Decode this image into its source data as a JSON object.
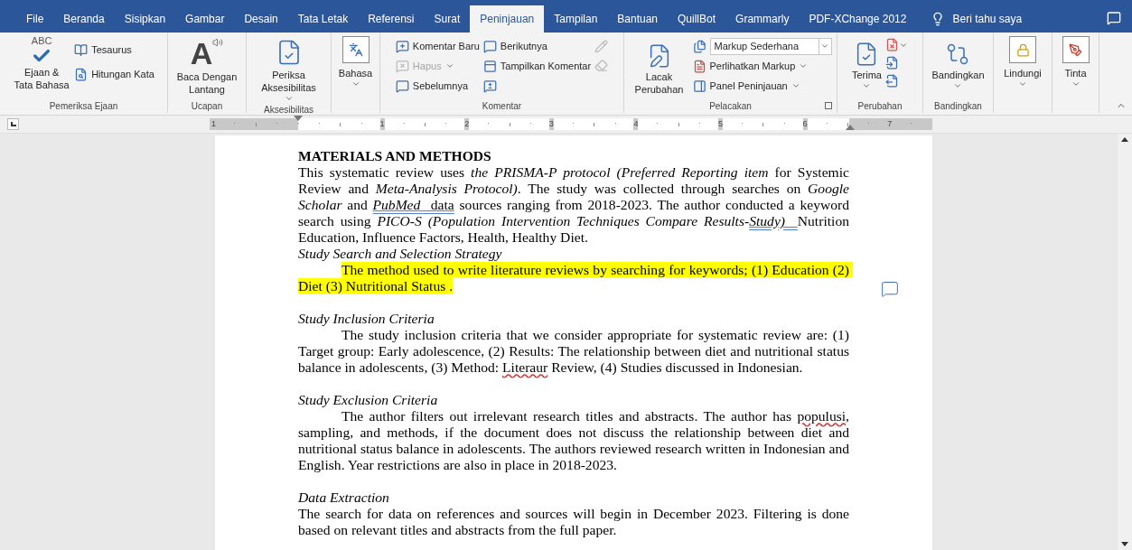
{
  "tabs": [
    {
      "label": "File",
      "selected": false
    },
    {
      "label": "Beranda",
      "selected": false
    },
    {
      "label": "Sisipkan",
      "selected": false
    },
    {
      "label": "Gambar",
      "selected": false
    },
    {
      "label": "Desain",
      "selected": false
    },
    {
      "label": "Tata Letak",
      "selected": false
    },
    {
      "label": "Referensi",
      "selected": false
    },
    {
      "label": "Surat",
      "selected": false
    },
    {
      "label": "Peninjauan",
      "selected": true
    },
    {
      "label": "Tampilan",
      "selected": false
    },
    {
      "label": "Bantuan",
      "selected": false
    },
    {
      "label": "QuillBot",
      "selected": false
    },
    {
      "label": "Grammarly",
      "selected": false
    },
    {
      "label": "PDF-XChange 2012",
      "selected": false
    }
  ],
  "tell_me": {
    "label": "Beri tahu saya"
  },
  "ribbon": {
    "groups": [
      {
        "label": "Pemeriksa Ejaan",
        "controls": [
          {
            "label": "Ejaan & Tata Bahasa",
            "icon_text": "ABC"
          },
          {
            "label": "Tesaurus"
          },
          {
            "label": "Hitungan Kata"
          }
        ]
      },
      {
        "label": "Ucapan",
        "controls": [
          {
            "label": "Baca Dengan Lantang",
            "icon_text": "A"
          }
        ]
      },
      {
        "label": "Aksesibilitas",
        "controls": [
          {
            "label": "Periksa Aksesibilitas"
          }
        ]
      },
      {
        "controls": [
          {
            "label": "Bahasa"
          }
        ]
      },
      {
        "label": "Komentar",
        "controls": [
          {
            "label": "Komentar Baru",
            "disabled": false
          },
          {
            "label": "Hapus",
            "disabled": true
          },
          {
            "label": "Sebelumnya",
            "disabled": false
          },
          {
            "label": "Berikutnya",
            "disabled": false
          },
          {
            "label": "Tampilkan Komentar",
            "disabled": false
          }
        ]
      },
      {
        "label": "Pelacakan",
        "controls": [
          {
            "label": "Lacak Perubahan"
          },
          {
            "value": "Markup Sederhana"
          },
          {
            "label": "Perlihatkan Markup"
          },
          {
            "label": "Panel Peninjauan"
          }
        ]
      },
      {
        "label": "Perubahan",
        "controls": [
          {
            "label": "Terima"
          }
        ]
      },
      {
        "label": "Bandingkan",
        "controls": [
          {
            "label": "Bandingkan"
          }
        ]
      },
      {
        "controls": [
          {
            "label": "Lindungi"
          }
        ]
      },
      {
        "controls": [
          {
            "label": "Tinta"
          }
        ]
      }
    ]
  },
  "ruler": {
    "numbers": [
      "1",
      "1",
      "2",
      "3",
      "4",
      "5",
      "6",
      "7"
    ]
  },
  "document": {
    "paragraphs": [
      {
        "kind": "heading",
        "runs": [
          {
            "text": "MATERIALS AND METHODS",
            "italic": false
          }
        ]
      },
      {
        "kind": "body",
        "gap_before": false,
        "indent": false,
        "highlight": false,
        "runs": [
          {
            "text": "This systematic review uses ",
            "italic": false
          },
          {
            "text": "the PRISMA-P protocol (Preferred Reporting item",
            "italic": true
          },
          {
            "text": " for Systemic Review and ",
            "italic": false
          },
          {
            "text": "Meta-Analysis Protocol)",
            "italic": true
          },
          {
            "text": ". The study was collected through searches on ",
            "italic": false
          },
          {
            "text": "Google Scholar",
            "italic": true
          },
          {
            "text": " and ",
            "italic": false
          },
          {
            "text": "PubMed",
            "italic": true,
            "kind": "grammar"
          },
          {
            "text": "  data",
            "italic": false,
            "kind": "grammar"
          },
          {
            "text": " sources ranging from 2018-2023. The author conducted a keyword search using ",
            "italic": false
          },
          {
            "text": "PICO-S (Population Intervention Techniques Compare Results-",
            "italic": true
          },
          {
            "text": "Study)  ",
            "italic": true,
            "kind": "grammar"
          },
          {
            "text": "Nutrition Education, Influence Factors, Health, Healthy Diet.",
            "italic": false
          }
        ]
      },
      {
        "kind": "subheading",
        "gap_before": false,
        "runs": [
          {
            "text": "Study Search and Selection Strategy",
            "italic": true
          }
        ]
      },
      {
        "kind": "body",
        "gap_before": false,
        "indent": true,
        "highlight": true,
        "runs": [
          {
            "text": "The method used to write literature reviews by searching for keywords; (1) Education (2) Diet (3) Nutritional Status .",
            "italic": false
          }
        ]
      },
      {
        "kind": "subheading",
        "gap_before": true,
        "runs": [
          {
            "text": "Study Inclusion Criteria",
            "italic": true
          }
        ]
      },
      {
        "kind": "body",
        "gap_before": false,
        "indent": true,
        "highlight": false,
        "runs": [
          {
            "text": "The study inclusion criteria that we consider appropriate for systematic review are: (1) Target group: Early adolescence, (2) Results: The relationship between diet and nutritional status balance in adolescents, (3) Method: ",
            "italic": false
          },
          {
            "text": "Literaur",
            "italic": false,
            "kind": "spelling"
          },
          {
            "text": " Review, (4) Studies discussed in Indonesian.",
            "italic": false
          }
        ]
      },
      {
        "kind": "subheading",
        "gap_before": true,
        "runs": [
          {
            "text": "Study Exclusion Criteria",
            "italic": true
          }
        ]
      },
      {
        "kind": "body",
        "gap_before": false,
        "indent": true,
        "highlight": false,
        "runs": [
          {
            "text": "The author filters out irrelevant research titles and abstracts. The author has ",
            "italic": false
          },
          {
            "text": "populusi",
            "italic": false,
            "kind": "spelling"
          },
          {
            "text": ", sampling, and methods, if the document does not discuss the relationship between diet and nutritional status balance in adolescents. The authors reviewed research written in Indonesian and English. Year restrictions are also in place in 2018-2023.",
            "italic": false
          }
        ]
      },
      {
        "kind": "subheading",
        "gap_before": true,
        "runs": [
          {
            "text": "Data Extraction",
            "italic": true
          }
        ]
      },
      {
        "kind": "body",
        "gap_before": false,
        "indent": false,
        "highlight": false,
        "runs": [
          {
            "text": "The search for data on references and sources will begin in December 2023. Filtering is done based on relevant titles and abstracts from the full paper.",
            "italic": false
          }
        ]
      }
    ]
  }
}
